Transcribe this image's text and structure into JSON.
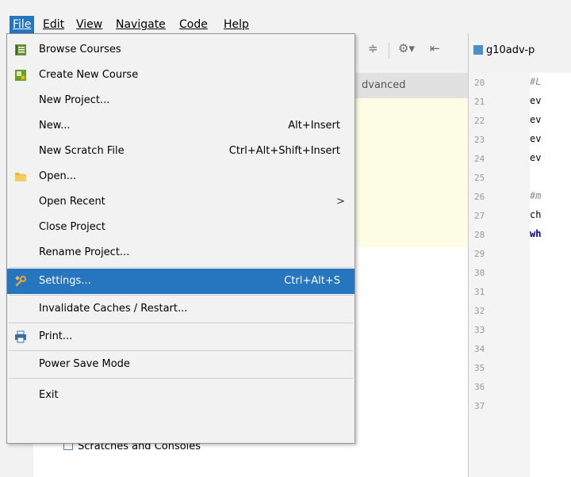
{
  "menubar": {
    "items": [
      {
        "label": "File"
      },
      {
        "label": "Edit"
      },
      {
        "label": "View"
      },
      {
        "label": "Navigate"
      },
      {
        "label": "Code"
      },
      {
        "label": "Help"
      }
    ]
  },
  "file_menu": {
    "browse_courses": "Browse Courses",
    "create_new_course": "Create New Course",
    "new_project": "New Project...",
    "new": "New...",
    "new_shortcut": "Alt+Insert",
    "new_scratch_file": "New Scratch File",
    "new_scratch_shortcut": "Ctrl+Alt+Shift+Insert",
    "open": "Open...",
    "open_recent": "Open Recent",
    "open_recent_arrow": ">",
    "close_project": "Close Project",
    "rename_project": "Rename Project...",
    "settings": "Settings...",
    "settings_shortcut": "Ctrl+Alt+S",
    "invalidate_caches": "Invalidate Caches / Restart...",
    "print": "Print...",
    "power_save_mode": "Power Save Mode",
    "exit": "Exit"
  },
  "project_panel": {
    "header": "dvanced",
    "scratches": "Scratches and Consoles"
  },
  "editor": {
    "tab_title": "g10adv-p",
    "line_numbers": [
      "20",
      "21",
      "22",
      "23",
      "24",
      "25",
      "26",
      "27",
      "28",
      "29",
      "30",
      "31",
      "32",
      "33",
      "34",
      "35",
      "36",
      "37"
    ],
    "lines": [
      "#L",
      "ev",
      "ev",
      "ev",
      "ev",
      "",
      "#m",
      "ch",
      "wh"
    ]
  },
  "colors": {
    "selection": "#2675bf",
    "menu_bg": "#f2f2f2",
    "panel_highlight": "#fdfde6"
  }
}
